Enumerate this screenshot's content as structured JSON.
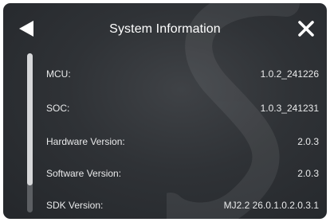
{
  "header": {
    "title": "System Information"
  },
  "info_rows": [
    {
      "label": "MCU:",
      "value": "1.0.2_241226"
    },
    {
      "label": "SOC:",
      "value": "1.0.3_241231"
    },
    {
      "label": "Hardware Version:",
      "value": "2.0.3"
    },
    {
      "label": "Software Version:",
      "value": "2.0.3"
    },
    {
      "label": "SDK Version:",
      "value": "MJ2.2 26.0.1.0.2.0.3.1"
    }
  ],
  "scrollbar": {
    "position": 0,
    "visible_fraction": 0.83
  },
  "icons": {
    "back": "back-arrow-icon",
    "close": "close-icon",
    "watermark": "brand-watermark"
  },
  "colors": {
    "background": "#2f3236",
    "text": "#e9eaeb",
    "title": "#ffffff"
  }
}
